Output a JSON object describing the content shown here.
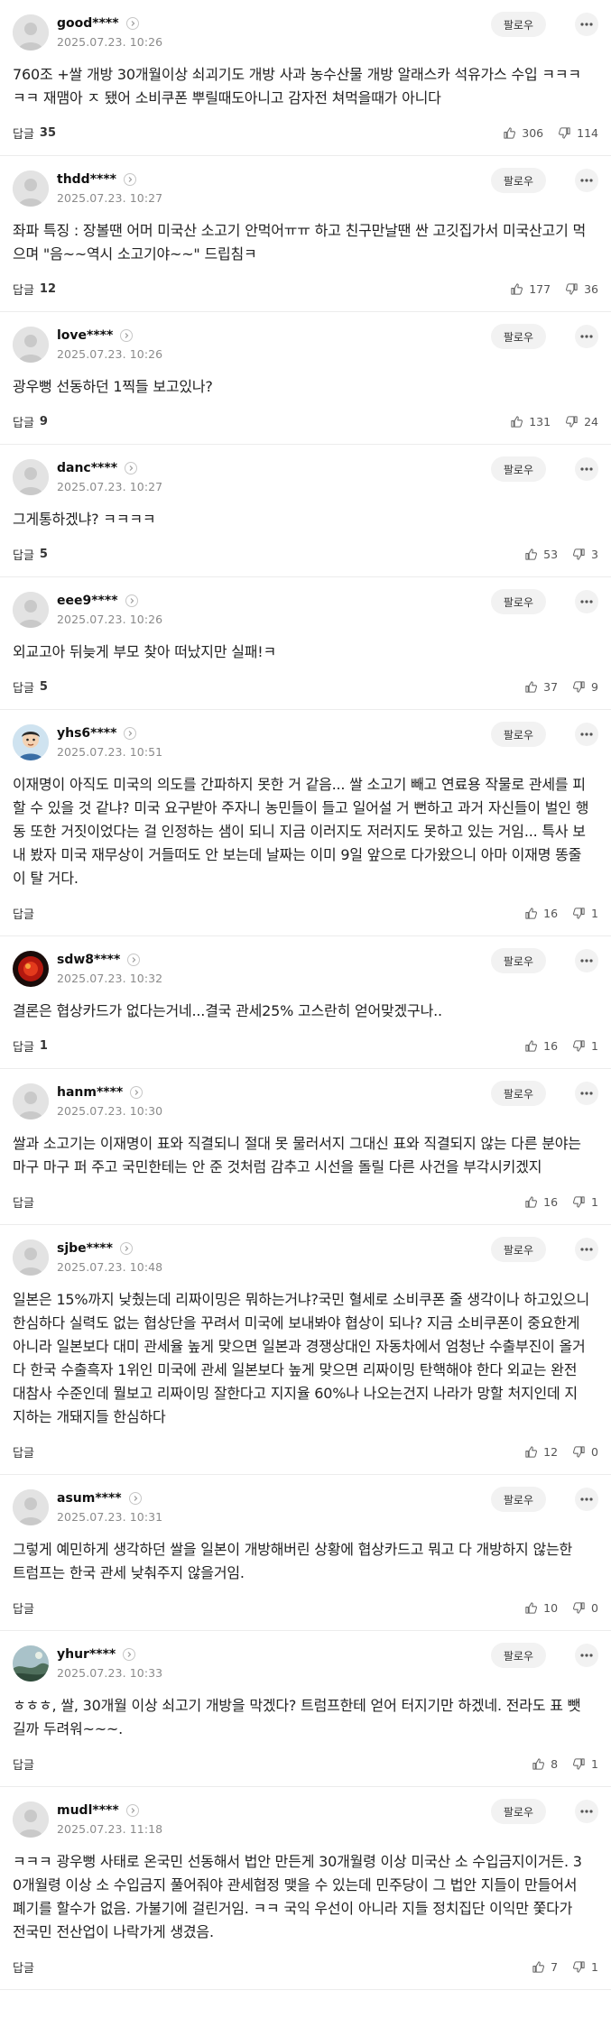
{
  "labels": {
    "follow": "팔로우",
    "reply": "답글"
  },
  "comments": [
    {
      "user": "good****",
      "date": "2025.07.23. 10:26",
      "avatar": "default",
      "text": "760조 +쌀 개방 30개월이상 쇠괴기도 개방 사과 농수산물 개방 알래스카 석유가스 수입 ㅋㅋㅋㅋㅋ 재맴아 ㅈ 됐어 소비쿠폰 뿌릴때도아니고 감자전 쳐먹을때가 아니다",
      "replies": "35",
      "likes": "306",
      "dislikes": "114"
    },
    {
      "user": "thdd****",
      "date": "2025.07.23. 10:27",
      "avatar": "default",
      "text": "좌파 특징 : 장볼땐 어머 미국산 소고기 안먹어ㅠㅠ 하고 친구만날땐 싼 고깃집가서 미국산고기 먹으며 \"음~~역시 소고기야~~\" 드립침ㅋ",
      "replies": "12",
      "likes": "177",
      "dislikes": "36"
    },
    {
      "user": "love****",
      "date": "2025.07.23. 10:26",
      "avatar": "default",
      "text": "광우뻥 선동하던 1찍들 보고있나?",
      "replies": "9",
      "likes": "131",
      "dislikes": "24"
    },
    {
      "user": "danc****",
      "date": "2025.07.23. 10:27",
      "avatar": "default",
      "text": "그게통하겠냐? ㅋㅋㅋㅋ",
      "replies": "5",
      "likes": "53",
      "dislikes": "3"
    },
    {
      "user": "eee9****",
      "date": "2025.07.23. 10:26",
      "avatar": "default",
      "text": "외교고아 뒤늦게 부모 찾아 떠났지만 실패!ㅋ",
      "replies": "5",
      "likes": "37",
      "dislikes": "9"
    },
    {
      "user": "yhs6****",
      "date": "2025.07.23. 10:51",
      "avatar": "cartoon",
      "text": "이재명이 아직도 미국의 의도를 간파하지 못한 거 같음... 쌀 소고기 빼고 연료용 작물로 관세를 피할 수 있을 것 같냐? 미국 요구받아 주자니 농민들이 들고 일어설 거 뻔하고 과거 자신들이 벌인 행동 또한 거짓이었다는 걸 인정하는 샘이 되니 지금 이러지도 저러지도 못하고 있는 거임... 특사 보내 봤자 미국 재무상이 거들떠도 안 보는데 날짜는 이미 9일 앞으로 다가왔으니 아마 이재명 똥줄이 탈 거다.",
      "replies": "",
      "likes": "16",
      "dislikes": "1"
    },
    {
      "user": "sdw8****",
      "date": "2025.07.23. 10:32",
      "avatar": "red",
      "text": "결론은 협상카드가 없다는거네...결국 관세25% 고스란히 얻어맞겠구나..",
      "replies": "1",
      "likes": "16",
      "dislikes": "1"
    },
    {
      "user": "hanm****",
      "date": "2025.07.23. 10:30",
      "avatar": "default",
      "text": "쌀과 소고기는 이재명이 표와 직결되니 절대 못 물러서지 그대신 표와 직결되지 않는 다른 분야는 마구 마구 퍼 주고 국민한테는 안 준 것처럼 감추고 시선을 돌릴 다른 사건을 부각시키겠지",
      "replies": "",
      "likes": "16",
      "dislikes": "1"
    },
    {
      "user": "sjbe****",
      "date": "2025.07.23. 10:48",
      "avatar": "default",
      "text": "일본은 15%까지 낮췄는데 리짜이밍은 뭐하는거냐?국민 혈세로 소비쿠폰 줄 생각이나 하고있으니 한심하다 실력도 없는 협상단을 꾸려서 미국에 보내봐야 협상이 되나? 지금 소비쿠폰이 중요한게 아니라 일본보다 대미 관세율 높게 맞으면 일본과 경쟁상대인 자동차에서 엄청난 수출부진이 올거다 한국 수출흑자 1위인 미국에 관세 일본보다 높게 맞으면 리짜이밍 탄핵해야 한다 외교는 완전 대참사 수준인데 뭘보고 리짜이밍 잘한다고 지지율 60%나 나오는건지 나라가 망할 처지인데 지지하는 개돼지들 한심하다",
      "replies": "",
      "likes": "12",
      "dislikes": "0"
    },
    {
      "user": "asum****",
      "date": "2025.07.23. 10:31",
      "avatar": "default",
      "text": "그렇게 예민하게 생각하던 쌀을 일본이 개방해버린 상황에 협상카드고 뭐고 다 개방하지 않는한 트럼프는 한국 관세 낮춰주지 않을거임.",
      "replies": "",
      "likes": "10",
      "dislikes": "0"
    },
    {
      "user": "yhur****",
      "date": "2025.07.23. 10:33",
      "avatar": "photo",
      "text": "ㅎㅎㅎ, 쌀, 30개월 이상 쇠고기 개방을 막겠다? 트럼프한테 얻어 터지기만 하겠네. 전라도 표 뺏길까 두려워~~~.",
      "replies": "",
      "likes": "8",
      "dislikes": "1"
    },
    {
      "user": "mudl****",
      "date": "2025.07.23. 11:18",
      "avatar": "default",
      "text": "ㅋㅋㅋ 광우뻥 사태로 온국민 선동해서 법안 만든게 30개월령 이상 미국산 소 수입금지이거든. 30개월령 이상 소 수입금지 풀어줘야 관세협정 맺을 수 있는데 민주당이 그 법안 지들이 만들어서 폐기를 할수가 없음. 가불기에 걸린거임. ㅋㅋ 국익 우선이 아니라 지들 정치집단 이익만 쫓다가 전국민 전산업이 나락가게 생겼음.",
      "replies": "",
      "likes": "7",
      "dislikes": "1"
    }
  ]
}
